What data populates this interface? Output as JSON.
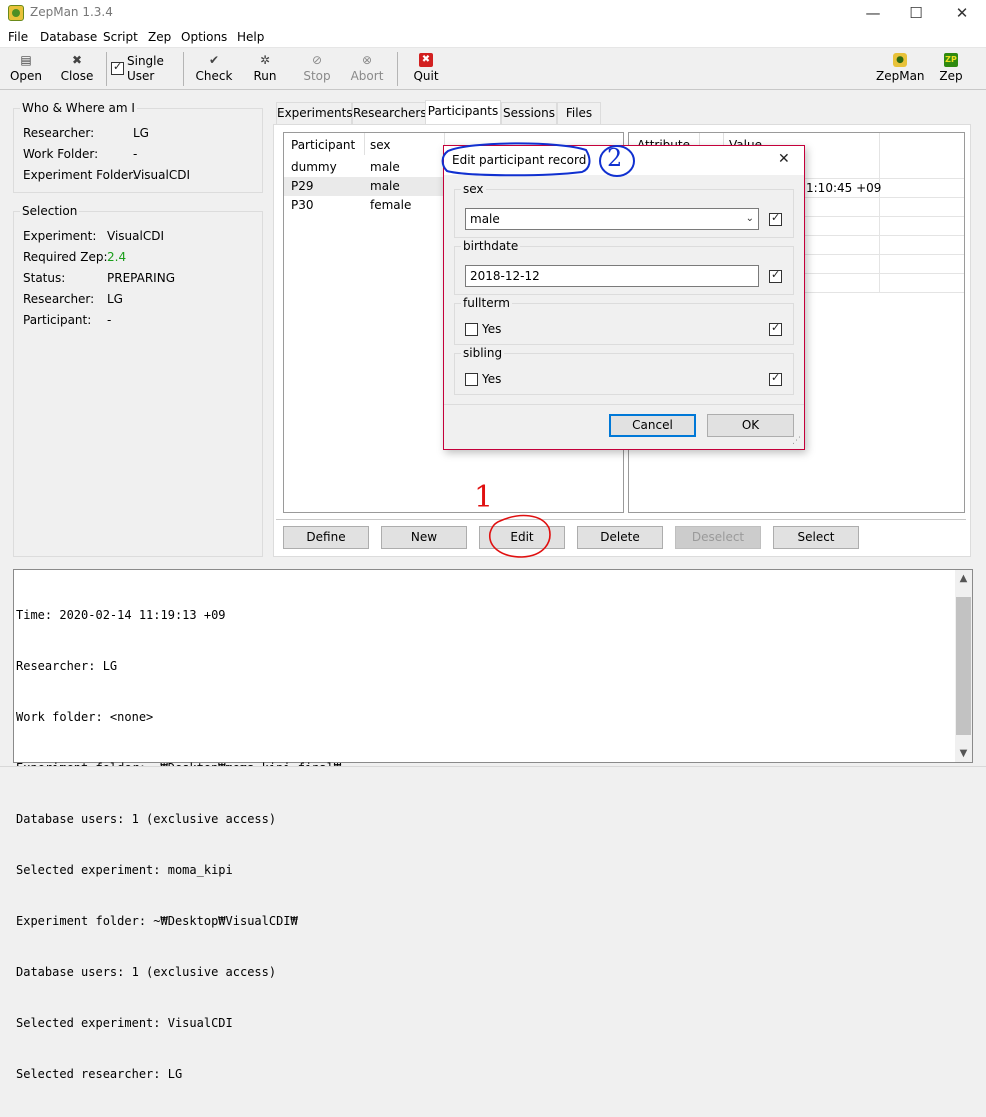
{
  "window": {
    "title": "ZepMan 1.3.4",
    "minimize_glyph": "—",
    "maximize_glyph": "☐",
    "close_glyph": "✕"
  },
  "menu": [
    "File",
    "Database",
    "Script",
    "Zep",
    "Options",
    "Help"
  ],
  "toolbar": {
    "open": "Open",
    "close": "Close",
    "single_user_line1": "Single",
    "single_user_line2": "User",
    "check": "Check",
    "run": "Run",
    "stop": "Stop",
    "abort": "Abort",
    "quit": "Quit",
    "zepman": "ZepMan",
    "zep": "Zep"
  },
  "who": {
    "title": "Who & Where am I",
    "researcher_label": "Researcher:",
    "researcher_value": "LG",
    "work_folder_label": "Work Folder:",
    "work_folder_value": "-",
    "experiment_folder_label": "Experiment Folder:",
    "experiment_folder_value": "VisualCDI"
  },
  "selection": {
    "title": "Selection",
    "experiment_label": "Experiment:",
    "experiment_value": "VisualCDI",
    "required_zep_label": "Required Zep:",
    "required_zep_value": "2.4",
    "status_label": "Status:",
    "status_value": "PREPARING",
    "researcher_label": "Researcher:",
    "researcher_value": "LG",
    "participant_label": "Participant:",
    "participant_value": "-"
  },
  "tabs": [
    "Experiments",
    "Researchers",
    "Participants",
    "Sessions",
    "Files"
  ],
  "participants": {
    "headers": [
      "Participant",
      "sex"
    ],
    "rows": [
      {
        "participant": "dummy",
        "sex": "male"
      },
      {
        "participant": "P29",
        "sex": "male"
      },
      {
        "participant": "P30",
        "sex": "female"
      }
    ]
  },
  "attributes": {
    "headers": [
      "Attribute",
      "Value"
    ],
    "visible_value": "1:10:45 +09"
  },
  "actions": {
    "define": "Define",
    "new": "New",
    "edit": "Edit",
    "delete": "Delete",
    "deselect": "Deselect",
    "select": "Select"
  },
  "log": [
    "Time: 2020-02-14 11:19:13 +09",
    "Researcher: LG",
    "Work folder: <none>",
    "Experiment folder: ~₩Desktop₩moma_kipi_final₩",
    "Database users: 1 (exclusive access)",
    "Selected experiment: moma_kipi",
    "Experiment folder: ~₩Desktop₩VisualCDI₩",
    "Database users: 1 (exclusive access)",
    "Selected experiment: VisualCDI",
    "Selected researcher: LG"
  ],
  "dialog": {
    "title": "Edit participant record",
    "close_glyph": "✕",
    "sex_label": "sex",
    "sex_value": "male",
    "birthdate_label": "birthdate",
    "birthdate_value": "2018-12-12",
    "fullterm_label": "fullterm",
    "fullterm_option": "Yes",
    "sibling_label": "sibling",
    "sibling_option": "Yes",
    "cancel": "Cancel",
    "ok": "OK"
  },
  "annotations": {
    "one": "1",
    "two": "2"
  },
  "colors": {
    "required_zep": "#1a9e1a",
    "quit_icon": "#d22020",
    "dialog_border": "#c4003a",
    "annotation_blue": "#1030d0",
    "annotation_red": "#e01010",
    "focus_blue": "#0078d7"
  }
}
